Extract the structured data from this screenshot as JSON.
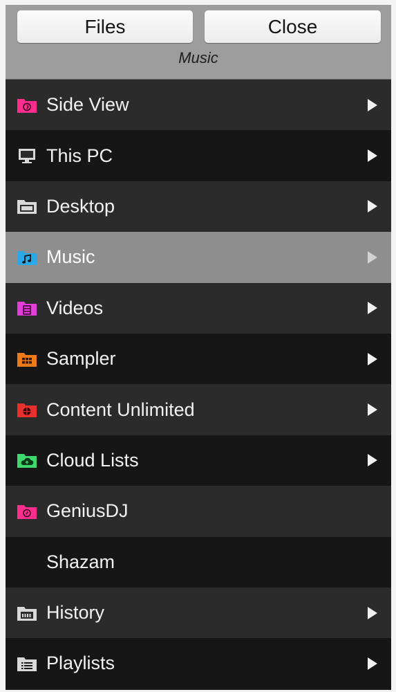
{
  "header": {
    "files_label": "Files",
    "close_label": "Close",
    "title": "Music"
  },
  "items": [
    {
      "label": "Side View",
      "icon": "sideview-folder-icon",
      "color": "#ff2d8e",
      "has_arrow": true,
      "selected": false
    },
    {
      "label": "This PC",
      "icon": "computer-icon",
      "color": "#d9d9d9",
      "has_arrow": true,
      "selected": false
    },
    {
      "label": "Desktop",
      "icon": "desktop-folder-icon",
      "color": "#d9d9d9",
      "has_arrow": true,
      "selected": false
    },
    {
      "label": "Music",
      "icon": "music-folder-icon",
      "color": "#2aa8e8",
      "has_arrow": true,
      "selected": true
    },
    {
      "label": "Videos",
      "icon": "videos-folder-icon",
      "color": "#e33fd8",
      "has_arrow": true,
      "selected": false
    },
    {
      "label": "Sampler",
      "icon": "sampler-folder-icon",
      "color": "#f07a18",
      "has_arrow": true,
      "selected": false
    },
    {
      "label": "Content Unlimited",
      "icon": "content-unlimited-folder-icon",
      "color": "#e8302f",
      "has_arrow": true,
      "selected": false
    },
    {
      "label": "Cloud Lists",
      "icon": "cloud-lists-folder-icon",
      "color": "#3fd86e",
      "has_arrow": true,
      "selected": false
    },
    {
      "label": "GeniusDJ",
      "icon": "geniusdj-folder-icon",
      "color": "#ff2d8e",
      "has_arrow": false,
      "selected": false
    },
    {
      "label": "Shazam",
      "icon": "",
      "color": "",
      "has_arrow": false,
      "selected": false
    },
    {
      "label": "History",
      "icon": "history-folder-icon",
      "color": "#d9d9d9",
      "has_arrow": true,
      "selected": false
    },
    {
      "label": "Playlists",
      "icon": "playlists-folder-icon",
      "color": "#d9d9d9",
      "has_arrow": true,
      "selected": false
    }
  ]
}
